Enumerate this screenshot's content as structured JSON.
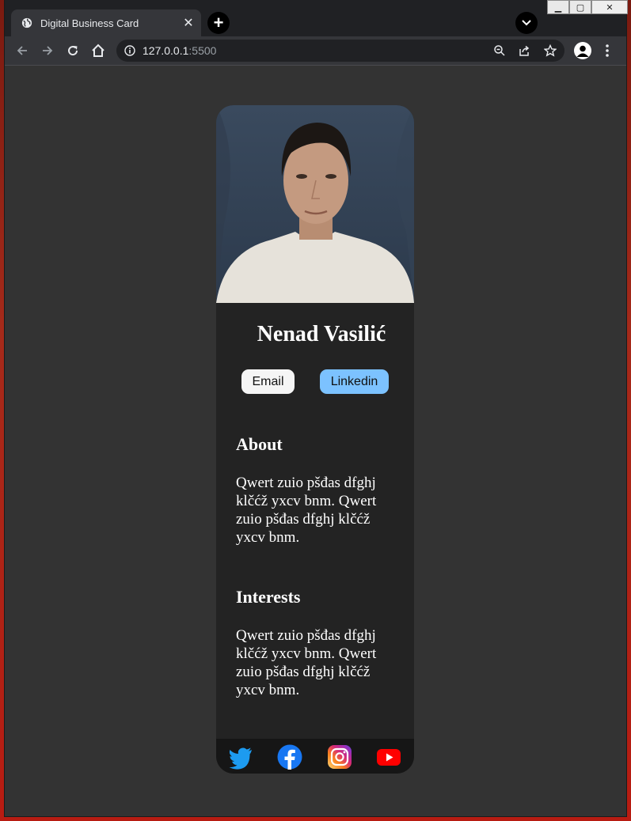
{
  "browser": {
    "tab_title": "Digital Business Card",
    "url_host": "127.0.0.1",
    "url_port": ":5500"
  },
  "card": {
    "name": "Nenad Vasilić",
    "buttons": {
      "email": "Email",
      "linkedin": "Linkedin"
    },
    "about": {
      "title": "About",
      "text": "Qwert zuio pšđas dfghj klčćž yxcv bnm. Qwert zuio pšđas dfghj klčćž yxcv bnm."
    },
    "interests": {
      "title": "Interests",
      "text": "Qwert zuio pšđas dfghj klčćž yxcv bnm. Qwert zuio pšđas dfghj klčćž yxcv bnm."
    },
    "social_icons": [
      "twitter-icon",
      "facebook-icon",
      "instagram-icon",
      "youtube-icon"
    ]
  },
  "colors": {
    "page_bg": "#333333",
    "card_bg": "#232323",
    "footer_bg": "#161616",
    "linkedin_button": "#7cc2ff",
    "email_button": "#f5f5f5"
  }
}
